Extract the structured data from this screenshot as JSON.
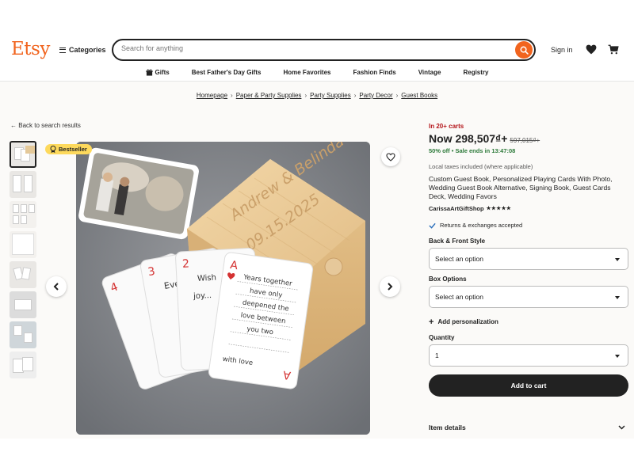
{
  "header": {
    "logo": "Etsy",
    "categories_label": "Categories",
    "search_placeholder": "Search for anything",
    "sign_in": "Sign in"
  },
  "nav": {
    "items": [
      "Gifts",
      "Best Father's Day Gifts",
      "Home Favorites",
      "Fashion Finds",
      "Vintage",
      "Registry"
    ]
  },
  "breadcrumb": [
    "Homepage",
    "Paper & Party Supplies",
    "Party Supplies",
    "Party Decor",
    "Guest Books"
  ],
  "back_link": "Back to search results",
  "badge": "Bestseller",
  "product": {
    "carts": "In 20+ carts",
    "price": "Now 298,507₫+",
    "original_price": "597,015₫+",
    "sale": "50% off • Sale ends in 13:47:08",
    "taxes": "Local taxes included (where applicable)",
    "title": "Custom Guest Book, Personalized Playing Cards With Photo, Wedding Guest Book Alternative, Signing Book, Guest Cards Deck, Wedding Favors",
    "shop": "CarissaArtGiftShop",
    "rating_stars": "★★★★★",
    "returns": "Returns & exchanges accepted"
  },
  "options": {
    "style_label": "Back & Front Style",
    "style_value": "Select an option",
    "box_label": "Box Options",
    "box_value": "Select an option",
    "personalization": "Add personalization",
    "quantity_label": "Quantity",
    "quantity_value": "1",
    "add_to_cart": "Add to cart",
    "item_details": "Item details"
  },
  "image_text": {
    "box_line1": "Andrew & Belinda",
    "box_line2": "09.15.2025",
    "card_text": [
      "Years together",
      "have only",
      "deepened the",
      "love between",
      "you two",
      "with love"
    ]
  },
  "colors": {
    "brand": "#f1641e",
    "sale_green": "#2d7a3a",
    "carts_red": "#b4161b",
    "badge_yellow": "#fdd95c"
  }
}
